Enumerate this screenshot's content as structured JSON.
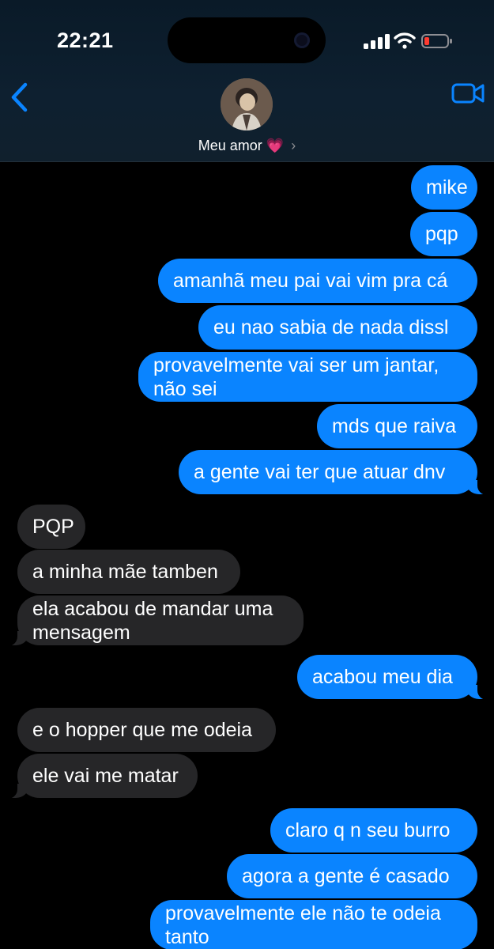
{
  "status": {
    "time": "22:21"
  },
  "contact": {
    "name": "Meu amor",
    "emoji": "💗",
    "chevron": "›"
  },
  "icons": {
    "back": "chevron-left-icon",
    "video": "video-camera-icon",
    "signal": "cellular-signal-icon",
    "wifi": "wifi-icon",
    "battery": "battery-low-icon"
  },
  "colors": {
    "sent_bubble": "#0a84ff",
    "received_bubble": "#262628",
    "accent": "#0a84ff",
    "battery_low": "#ff3b30"
  },
  "messages": [
    {
      "side": "sent",
      "text": "mike"
    },
    {
      "side": "sent",
      "text": "pqp"
    },
    {
      "side": "sent",
      "text": "amanhã meu pai vai vim pra cá"
    },
    {
      "side": "sent",
      "text": "eu nao sabia de nada dissl"
    },
    {
      "side": "sent",
      "text": "provavelmente vai ser um jantar, não sei"
    },
    {
      "side": "sent",
      "text": "mds que raiva"
    },
    {
      "side": "sent",
      "text": "a gente vai ter que atuar dnv"
    },
    {
      "side": "received",
      "text": "PQP"
    },
    {
      "side": "received",
      "text": "a minha mãe tamben"
    },
    {
      "side": "received",
      "text": "ela acabou de mandar uma mensagem"
    },
    {
      "side": "sent",
      "text": "acabou meu dia"
    },
    {
      "side": "received",
      "text": "e o hopper que me odeia"
    },
    {
      "side": "received",
      "text": "ele vai me matar"
    },
    {
      "side": "sent",
      "text": "claro q n seu burro"
    },
    {
      "side": "sent",
      "text": "agora a gente é casado"
    },
    {
      "side": "sent",
      "text": "provavelmente ele não te odeia tanto"
    }
  ]
}
